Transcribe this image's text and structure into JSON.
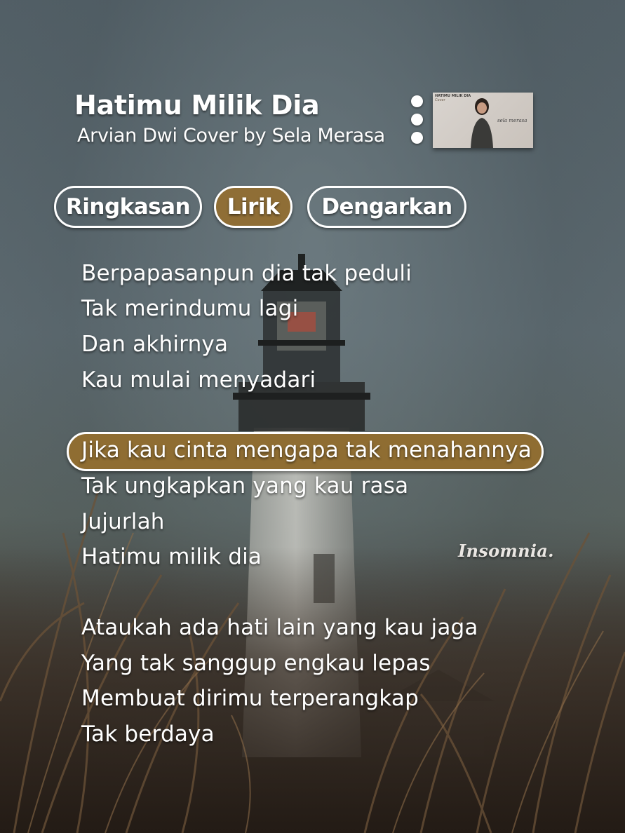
{
  "song": {
    "title": "Hatimu Milik Dia",
    "artist": "Arvian Dwi Cover by Sela Merasa"
  },
  "header": {
    "more_icon": "more-vertical-icon",
    "cover_thumbnail": {
      "title": "HATIMU MILIK DIA",
      "subtitle": "Cover",
      "signature": "sela merasa"
    }
  },
  "tabs": [
    {
      "label": "Ringkasan",
      "active": false
    },
    {
      "label": "Lirik",
      "active": true
    },
    {
      "label": "Dengarkan",
      "active": false
    }
  ],
  "lyrics": [
    {
      "text": "Berpapasanpun dia tak peduli"
    },
    {
      "text": "Tak merindumu lagi"
    },
    {
      "text": "Dan akhirnya"
    },
    {
      "text": "Kau mulai menyadari"
    },
    {
      "text": "Jika kau cinta mengapa tak menahannya",
      "active": true
    },
    {
      "text": "Tak ungkapkan yang kau rasa"
    },
    {
      "text": "Jujurlah"
    },
    {
      "text": "Hatimu milik dia"
    },
    {
      "text": "Ataukah ada hati lain yang kau jaga"
    },
    {
      "text": "Yang tak sanggup engkau lepas"
    },
    {
      "text": "Membuat dirimu terperangkap"
    },
    {
      "text": "Tak berdaya"
    }
  ],
  "watermark": "Insomnia.",
  "colors": {
    "accent": "#8f6e36",
    "text": "#ffffff"
  }
}
